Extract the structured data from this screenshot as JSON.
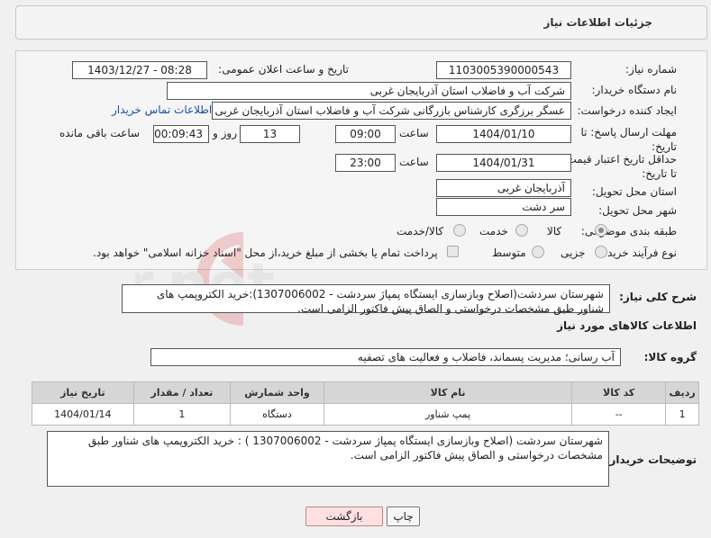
{
  "header": {
    "title": "جزئیات اطلاعات نیاز"
  },
  "form": {
    "need_number_label": "شماره نیاز:",
    "need_number": "1103005390000543",
    "announce_label": "تاریخ و ساعت اعلان عمومی:",
    "announce_value": "1403/12/27 - 08:28",
    "buyer_org_label": "نام دستگاه خریدار:",
    "buyer_org": "شرکت آب و فاضلاب استان آذربایجان غربی",
    "creator_label": "ایجاد کننده درخواست:",
    "creator": "عسگر  برزگری کارشناس بازرگانی شرکت آب و فاضلاب استان آذربایجان غربی",
    "contact_link": "اطلاعات تماس خریدار",
    "deadline_label": "مهلت ارسال پاسخ: تا تاریخ:",
    "deadline_date": "1404/01/10",
    "time_label": "ساعت",
    "deadline_time": "09:00",
    "days_value": "13",
    "days_label": "روز و",
    "remaining_value": "00:09:43",
    "remaining_label": "ساعت باقی مانده",
    "validity_label": "حداقل تاریخ اعتبار قیمت: تا تاریخ:",
    "validity_date": "1404/01/31",
    "validity_time": "23:00",
    "province_label": "استان محل تحویل:",
    "province": "آذربایجان غربی",
    "city_label": "شهر محل تحویل:",
    "city": "سر دشت",
    "category_label": "طبقه بندی موضوعی:",
    "category_options": [
      "کالا",
      "خدمت",
      "کالا/خدمت"
    ],
    "process_label": "نوع فرآیند خرید :",
    "process_options": [
      "جزیی",
      "متوسط"
    ],
    "payment_note": "پرداخت تمام یا بخشی از مبلغ خرید،از محل \"اسناد خزانه اسلامی\" خواهد بود."
  },
  "summary": {
    "label": "شرح کلی نیاز:",
    "text": "شهرستان سردشت(اصلاح وبازسازی ایستگاه پمپاژ سردشت - 1307006002):خرید الکتروپمپ های شناور طبق مشخصات درخواستی و الصاق پیش فاکتور الزامی است."
  },
  "goods": {
    "section_title": "اطلاعات کالاهای مورد نیاز",
    "group_label": "گروه کالا:",
    "group_value": "آب رسانی؛ مدیریت پسماند، فاضلاب و فعالیت های تصفیه",
    "columns": [
      "ردیف",
      "کد کالا",
      "نام کالا",
      "واحد شمارش",
      "تعداد / مقدار",
      "تاریخ نیاز"
    ],
    "rows": [
      {
        "row": "1",
        "code": "--",
        "name": "پمپ شناور",
        "unit": "دستگاه",
        "qty": "1",
        "date": "1404/01/14"
      }
    ]
  },
  "buyer_notes": {
    "label": "توضیحات خریدار:",
    "text": "شهرستان سردشت (اصلاح وبازسازی ایستگاه پمپاژ سردشت  - 1307006002 ) : خرید الکتروپمپ های شناور طبق مشخصات درخواستی و الصاق پیش فاکتور الزامی است."
  },
  "buttons": {
    "print": "چاپ",
    "back": "بازگشت"
  },
  "watermark": {
    "text": "AriaTender.net"
  }
}
